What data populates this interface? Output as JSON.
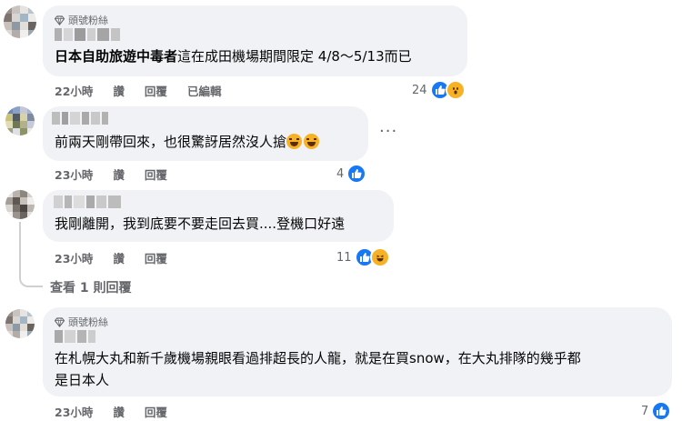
{
  "comments": [
    {
      "badge": "頭號粉絲",
      "name_bold": "日本自助旅遊中毒者",
      "text": "這在成田機場期間限定 4/8〜5/13而已",
      "time": "22小時",
      "like": "讚",
      "reply": "回覆",
      "edited": "已編輯",
      "reaction_count": "24",
      "reactions": [
        "like-icon",
        "wow-icon"
      ]
    },
    {
      "text": "前兩天剛帶回來，也很驚訝居然沒人搶",
      "emojis": [
        "laugh-cry-emoji",
        "laugh-cry-emoji"
      ],
      "more": "···",
      "time": "23小時",
      "like": "讚",
      "reply": "回覆",
      "reaction_count": "4",
      "reactions": [
        "like-icon"
      ]
    },
    {
      "text": "我剛離開，我到底要不要走回去買....登機口好遠",
      "time": "23小時",
      "like": "讚",
      "reply": "回覆",
      "reaction_count": "11",
      "reactions": [
        "like-icon",
        "haha-icon"
      ]
    },
    {
      "badge": "頭號粉絲",
      "text_line1": "在札幌大丸和新千歲機場親眼看過排超長的人龍，就是在買snow，在大丸排隊的幾乎都",
      "text_line2": "是日本人",
      "time": "23小時",
      "like": "讚",
      "reply": "回覆",
      "reaction_count": "7",
      "reactions": [
        "like-icon"
      ]
    }
  ],
  "view_replies": "查看 1 則回覆",
  "colors": {
    "bubble": "#f0f2f5",
    "secondary_text": "#65676b",
    "like_blue": "#1877f2",
    "emoji_yellow": "#f7b125"
  }
}
